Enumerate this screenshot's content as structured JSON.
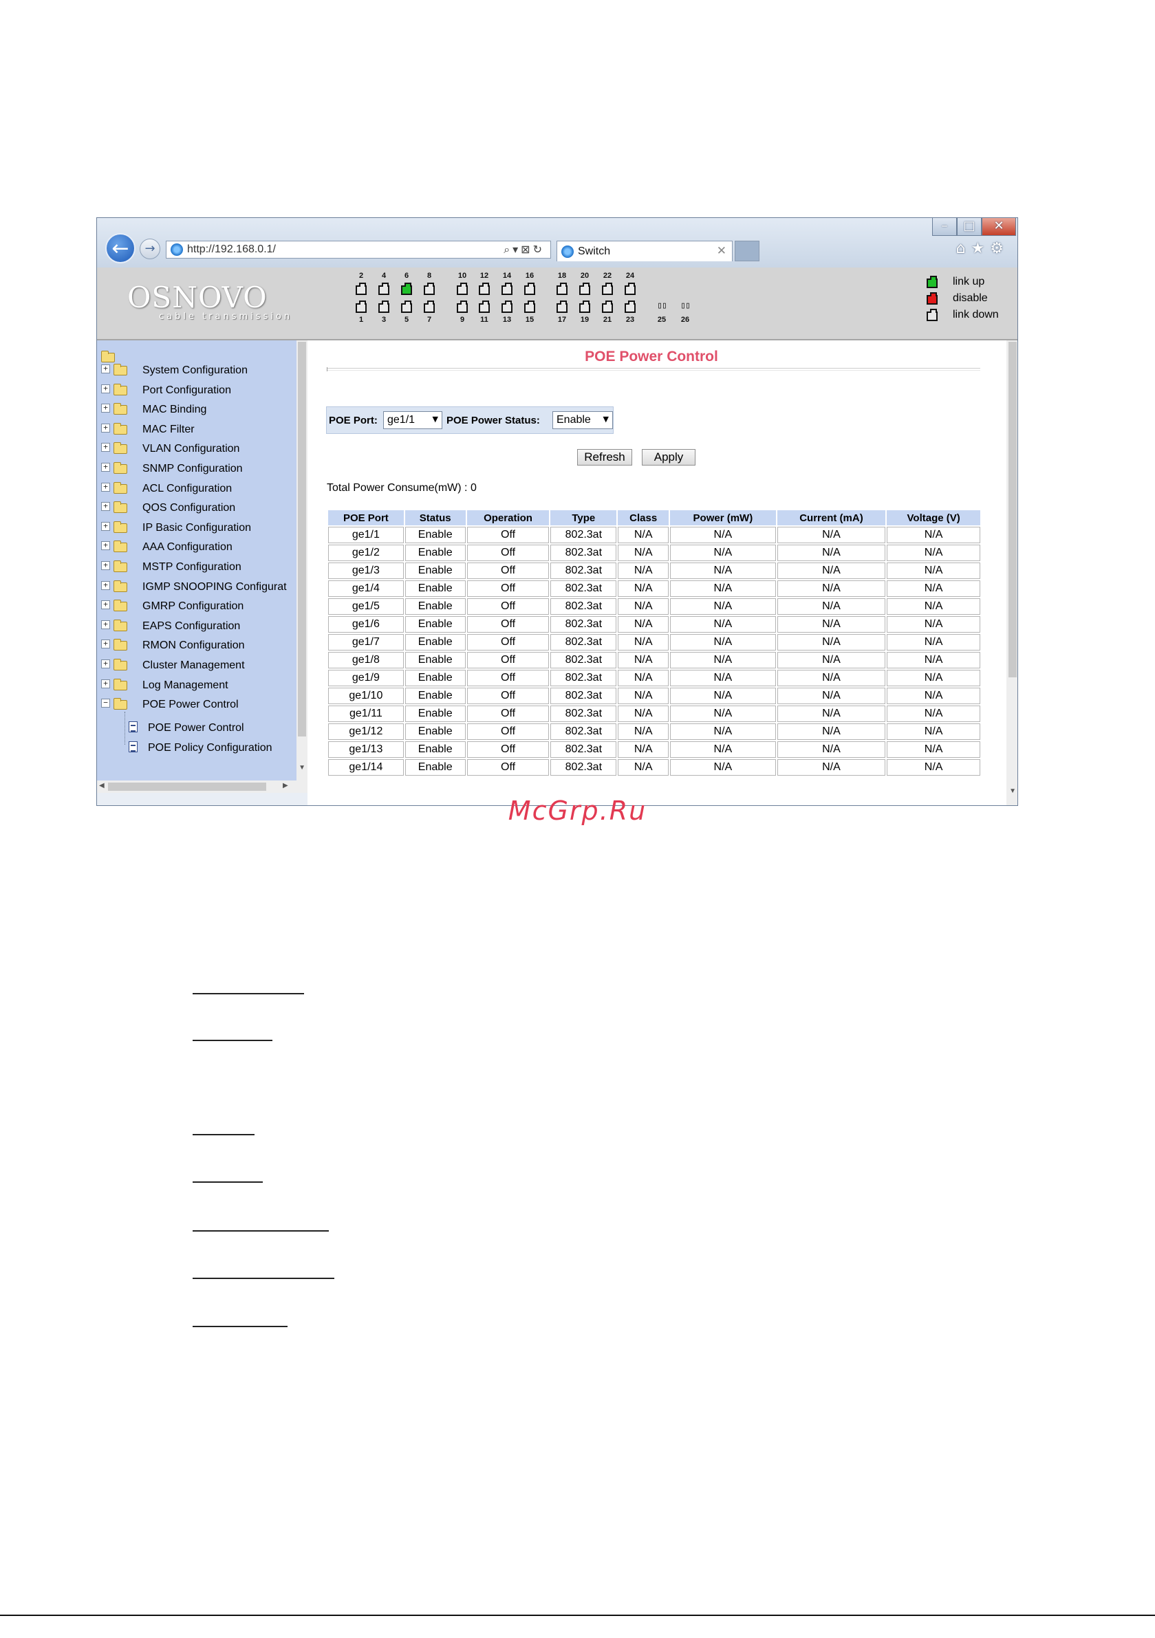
{
  "browser": {
    "url": "http://192.168.0.1/",
    "tab_title": "Switch",
    "win_minimize": "–",
    "win_maximize": "□",
    "win_close": "✕"
  },
  "header": {
    "logo": "OSNOVO",
    "logo_sub": "cable transmission",
    "top_ports": [
      "2",
      "4",
      "6",
      "8",
      "10",
      "12",
      "14",
      "16",
      "18",
      "20",
      "22",
      "24"
    ],
    "bottom_ports": [
      "1",
      "3",
      "5",
      "7",
      "9",
      "11",
      "13",
      "15",
      "17",
      "19",
      "21",
      "23"
    ],
    "fiber_ports": [
      "25",
      "26"
    ],
    "linkup_ports": [
      "6"
    ],
    "legend": {
      "link_up": "link up",
      "disable": "disable",
      "link_down": "link down"
    },
    "colors": {
      "link_up": "#1fbf2a",
      "disable": "#e11a1a",
      "link_down": "#e8e8e8"
    }
  },
  "sidebar": {
    "items": [
      {
        "label": "System Configuration"
      },
      {
        "label": "Port Configuration"
      },
      {
        "label": "MAC Binding"
      },
      {
        "label": "MAC Filter"
      },
      {
        "label": "VLAN Configuration"
      },
      {
        "label": "SNMP Configuration"
      },
      {
        "label": "ACL Configuration"
      },
      {
        "label": "QOS Configuration"
      },
      {
        "label": "IP Basic Configuration"
      },
      {
        "label": "AAA Configuration"
      },
      {
        "label": "MSTP Configuration"
      },
      {
        "label": "IGMP SNOOPING Configurat"
      },
      {
        "label": "GMRP Configuration"
      },
      {
        "label": "EAPS Configuration"
      },
      {
        "label": "RMON Configuration"
      },
      {
        "label": "Cluster Management"
      },
      {
        "label": "Log Management"
      },
      {
        "label": "POE Power Control",
        "expanded": true
      }
    ],
    "subitems": [
      {
        "label": "POE Power Control"
      },
      {
        "label": "POE Policy Configuration"
      }
    ]
  },
  "main": {
    "title": "POE Power Control",
    "poe_port_label": "POE Port:",
    "poe_port_value": "ge1/1",
    "power_status_label": "POE Power Status:",
    "power_status_value": "Enable",
    "refresh_label": "Refresh",
    "apply_label": "Apply",
    "total_power": "Total Power Consume(mW) : 0",
    "table": {
      "headers": [
        "POE Port",
        "Status",
        "Operation",
        "Type",
        "Class",
        "Power (mW)",
        "Current (mA)",
        "Voltage (V)"
      ],
      "rows": [
        [
          "ge1/1",
          "Enable",
          "Off",
          "802.3at",
          "N/A",
          "N/A",
          "N/A",
          "N/A"
        ],
        [
          "ge1/2",
          "Enable",
          "Off",
          "802.3at",
          "N/A",
          "N/A",
          "N/A",
          "N/A"
        ],
        [
          "ge1/3",
          "Enable",
          "Off",
          "802.3at",
          "N/A",
          "N/A",
          "N/A",
          "N/A"
        ],
        [
          "ge1/4",
          "Enable",
          "Off",
          "802.3at",
          "N/A",
          "N/A",
          "N/A",
          "N/A"
        ],
        [
          "ge1/5",
          "Enable",
          "Off",
          "802.3at",
          "N/A",
          "N/A",
          "N/A",
          "N/A"
        ],
        [
          "ge1/6",
          "Enable",
          "Off",
          "802.3at",
          "N/A",
          "N/A",
          "N/A",
          "N/A"
        ],
        [
          "ge1/7",
          "Enable",
          "Off",
          "802.3at",
          "N/A",
          "N/A",
          "N/A",
          "N/A"
        ],
        [
          "ge1/8",
          "Enable",
          "Off",
          "802.3at",
          "N/A",
          "N/A",
          "N/A",
          "N/A"
        ],
        [
          "ge1/9",
          "Enable",
          "Off",
          "802.3at",
          "N/A",
          "N/A",
          "N/A",
          "N/A"
        ],
        [
          "ge1/10",
          "Enable",
          "Off",
          "802.3at",
          "N/A",
          "N/A",
          "N/A",
          "N/A"
        ],
        [
          "ge1/11",
          "Enable",
          "Off",
          "802.3at",
          "N/A",
          "N/A",
          "N/A",
          "N/A"
        ],
        [
          "ge1/12",
          "Enable",
          "Off",
          "802.3at",
          "N/A",
          "N/A",
          "N/A",
          "N/A"
        ],
        [
          "ge1/13",
          "Enable",
          "Off",
          "802.3at",
          "N/A",
          "N/A",
          "N/A",
          "N/A"
        ],
        [
          "ge1/14",
          "Enable",
          "Off",
          "802.3at",
          "N/A",
          "N/A",
          "N/A",
          "N/A"
        ]
      ]
    }
  },
  "watermark": "McGrp.Ru"
}
